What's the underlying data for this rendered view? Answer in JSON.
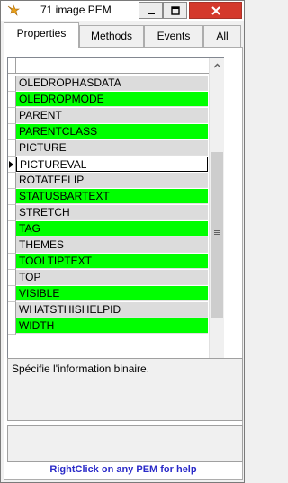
{
  "window": {
    "title": "71 image PEM"
  },
  "tabs": [
    {
      "label": "Properties",
      "active": true
    },
    {
      "label": "Methods",
      "active": false
    },
    {
      "label": "Events",
      "active": false
    },
    {
      "label": "All",
      "active": false
    }
  ],
  "properties": [
    {
      "name": "OLEDROPHASDATA",
      "color": "gray"
    },
    {
      "name": "OLEDROPMODE",
      "color": "green"
    },
    {
      "name": "PARENT",
      "color": "gray"
    },
    {
      "name": "PARENTCLASS",
      "color": "green"
    },
    {
      "name": "PICTURE",
      "color": "gray"
    },
    {
      "name": "PICTUREVAL",
      "color": "white",
      "current": true
    },
    {
      "name": "ROTATEFLIP",
      "color": "gray"
    },
    {
      "name": "STATUSBARTEXT",
      "color": "green"
    },
    {
      "name": "STRETCH",
      "color": "gray"
    },
    {
      "name": "TAG",
      "color": "green"
    },
    {
      "name": "THEMES",
      "color": "gray"
    },
    {
      "name": "TOOLTIPTEXT",
      "color": "green"
    },
    {
      "name": "TOP",
      "color": "gray"
    },
    {
      "name": "VISIBLE",
      "color": "green"
    },
    {
      "name": "WHATSTHISHELPID",
      "color": "gray"
    },
    {
      "name": "WIDTH",
      "color": "green"
    }
  ],
  "description": "Spécifie l'information binaire.",
  "help_text": "RightClick on any PEM for help",
  "colors": {
    "green": "#00ff00",
    "gray": "#dcdcdc",
    "close": "#d4392c",
    "help": "#2a2ac8"
  },
  "icons": {
    "app": "fox-icon",
    "minimize": "minimize-icon",
    "maximize": "maximize-icon",
    "close": "close-icon"
  }
}
